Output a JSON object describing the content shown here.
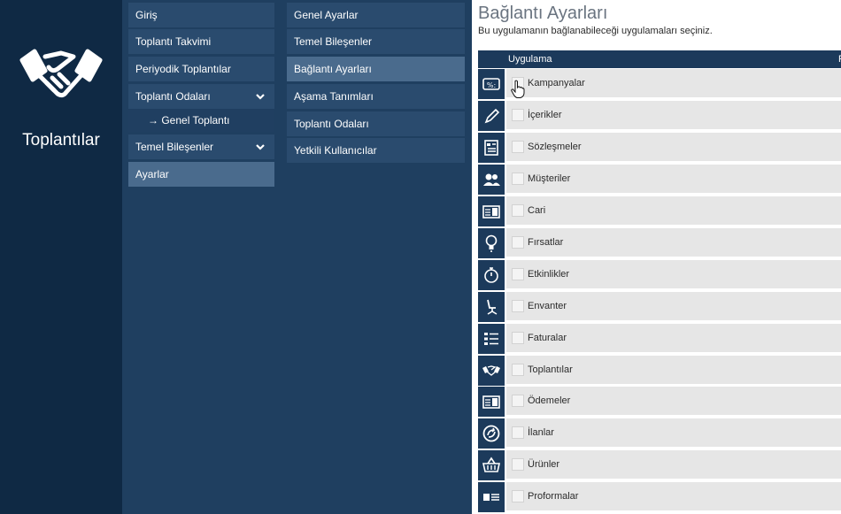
{
  "app": {
    "title": "Toplantılar",
    "logo_icon": "handshake-icon"
  },
  "nav1": {
    "items": [
      {
        "label": "Giriş",
        "active": false
      },
      {
        "label": "Toplantı Takvimi",
        "active": false
      },
      {
        "label": "Periyodik Toplantılar",
        "active": false
      },
      {
        "label": "Toplantı Odaları",
        "active": false,
        "expandable": true
      },
      {
        "label": "→ Genel Toplantı",
        "active": false,
        "sub": true
      },
      {
        "label": "Temel Bileşenler",
        "active": false,
        "expandable": true
      },
      {
        "label": "Ayarlar",
        "active": true
      }
    ]
  },
  "nav2": {
    "items": [
      {
        "label": "Genel Ayarlar",
        "active": false
      },
      {
        "label": "Temel Bileşenler",
        "active": false
      },
      {
        "label": "Bağlantı Ayarları",
        "active": true
      },
      {
        "label": "Aşama Tanımları",
        "active": false
      },
      {
        "label": "Toplantı Odaları",
        "active": false
      },
      {
        "label": "Yetkili Kullanıcılar",
        "active": false
      }
    ]
  },
  "main": {
    "title": "Bağlantı Ayarları",
    "description": "Bu uygulamanın bağlanabileceği uygulamaları seçiniz.",
    "table": {
      "column_app": "Uygulama",
      "column_extra": "P",
      "rows": [
        {
          "label": "Kampanyalar",
          "icon": "percent-tag-icon",
          "checked": false
        },
        {
          "label": "İçerikler",
          "icon": "pen-icon",
          "checked": false
        },
        {
          "label": "Sözleşmeler",
          "icon": "document-icon",
          "checked": false
        },
        {
          "label": "Müşteriler",
          "icon": "users-icon",
          "checked": false
        },
        {
          "label": "Cari",
          "icon": "ledger-card-icon",
          "checked": false
        },
        {
          "label": "Fırsatlar",
          "icon": "lightbulb-icon",
          "checked": false
        },
        {
          "label": "Etkinlikler",
          "icon": "stopwatch-icon",
          "checked": false
        },
        {
          "label": "Envanter",
          "icon": "office-chair-icon",
          "checked": false
        },
        {
          "label": "Faturalar",
          "icon": "invoice-list-icon",
          "checked": false
        },
        {
          "label": "Toplantılar",
          "icon": "handshake-icon",
          "checked": false
        },
        {
          "label": "Ödemeler",
          "icon": "payment-card-icon",
          "checked": false
        },
        {
          "label": "İlanlar",
          "icon": "announcement-circle-icon",
          "checked": false
        },
        {
          "label": "Ürünler",
          "icon": "basket-icon",
          "checked": false
        },
        {
          "label": "Proformalar",
          "icon": "proforma-card-icon",
          "checked": false
        }
      ]
    }
  },
  "colors": {
    "app_bg": "#0f2944",
    "nav_bg": "#1f3f60",
    "nav_item": "#2a4b6e",
    "nav_active": "#4a6b8d",
    "header": "#1c3a5b",
    "row_bg": "#e6e6e6"
  }
}
